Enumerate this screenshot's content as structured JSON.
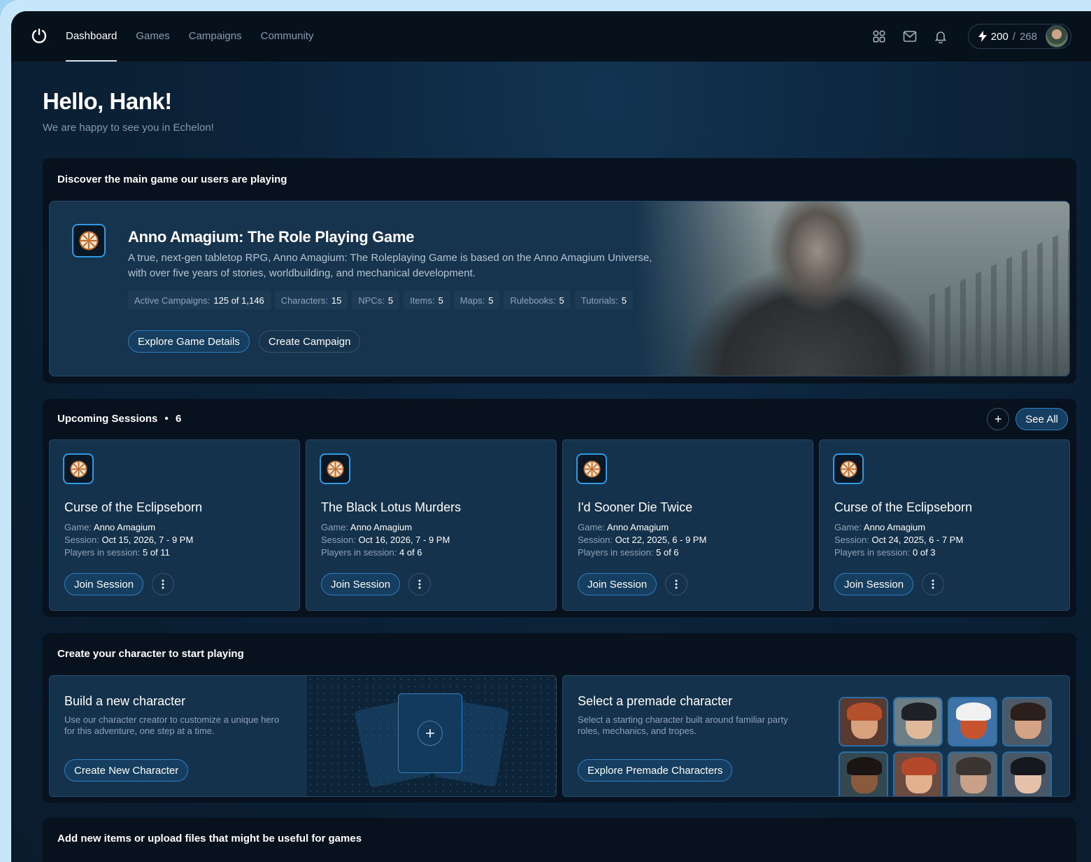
{
  "nav": {
    "links": [
      {
        "label": "Dashboard",
        "active": true
      },
      {
        "label": "Games",
        "active": false
      },
      {
        "label": "Campaigns",
        "active": false
      },
      {
        "label": "Community",
        "active": false
      }
    ],
    "icons": [
      "apps-icon",
      "mail-icon",
      "bell-icon"
    ],
    "energy": {
      "current": "200",
      "separator": "/",
      "max": "268"
    }
  },
  "greeting": {
    "title": "Hello, Hank!",
    "subtitle": "We are happy to see you in Echelon!"
  },
  "featured": {
    "section_title": "Discover the main game our users are playing",
    "title": "Anno Amagium: The Role Playing Game",
    "description": "A true, next-gen tabletop RPG, Anno Amagium: The Roleplaying Game is based on the Anno Amagium Universe, with over five years of stories, worldbuilding, and mechanical development.",
    "stats": [
      {
        "label": "Active Campaigns:",
        "value": "125 of 1,146"
      },
      {
        "label": "Characters:",
        "value": "15"
      },
      {
        "label": "NPCs:",
        "value": "5"
      },
      {
        "label": "Items:",
        "value": "5"
      },
      {
        "label": "Maps:",
        "value": "5"
      },
      {
        "label": "Rulebooks:",
        "value": "5"
      },
      {
        "label": "Tutorials:",
        "value": "5"
      }
    ],
    "primary_button": "Explore Game Details",
    "secondary_button": "Create Campaign"
  },
  "sessions": {
    "section_title": "Upcoming Sessions",
    "bullet": "•",
    "count": "6",
    "add_label": "+",
    "see_all": "See All",
    "labels": {
      "game": "Game:",
      "session": "Session:",
      "players": "Players in session:"
    },
    "join_label": "Join Session",
    "items": [
      {
        "title": "Curse of the Eclipseborn",
        "game": "Anno Amagium",
        "session": "Oct 15, 2026, 7 - 9 PM",
        "players": "5 of 11"
      },
      {
        "title": "The Black Lotus Murders",
        "game": "Anno Amagium",
        "session": "Oct 16, 2026, 7 - 9 PM",
        "players": "4 of 6"
      },
      {
        "title": "I'd Sooner Die Twice",
        "game": "Anno Amagium",
        "session": "Oct 22, 2025, 6 - 9 PM",
        "players": "5 of 6"
      },
      {
        "title": "Curse of the Eclipseborn",
        "game": "Anno Amagium",
        "session": "Oct 24, 2025, 6 - 7 PM",
        "players": "0 of 3"
      }
    ]
  },
  "create_character": {
    "section_title": "Create your character to start playing",
    "new": {
      "title": "Build a new character",
      "description": "Use our character creator to customize a unique hero for this adventure, one step at a time.",
      "button": "Create New Character"
    },
    "premade": {
      "title": "Select a premade character",
      "description": "Select a starting character built around familiar party roles, mechanics, and tropes.",
      "button": "Explore Premade Characters"
    }
  },
  "items": {
    "section_title": "Add new items or upload files that might be useful for games"
  },
  "colors": {
    "accent": "#2e9ae6",
    "background": "#0b2238",
    "panel": "#07121e",
    "card": "#15324c"
  }
}
